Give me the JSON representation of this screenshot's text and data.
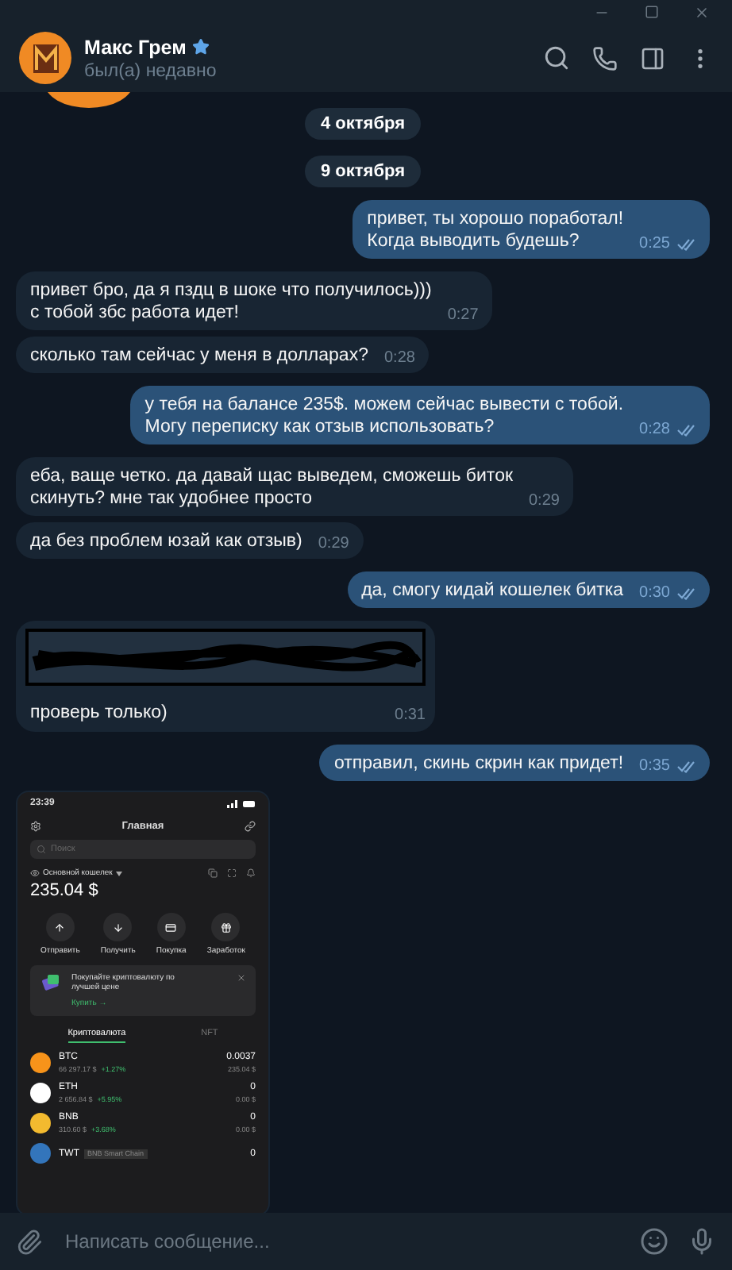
{
  "contact": {
    "name": "Макс Грем",
    "status": "был(а) недавно",
    "verified": true
  },
  "messages": [
    {
      "kind": "date",
      "text": "4 октября"
    },
    {
      "kind": "date",
      "text": "9 октября"
    },
    {
      "kind": "text",
      "outgoing": true,
      "text": "привет, ты хорошо поработал!\nКогда выводить будешь?",
      "time": "0:25",
      "read": true
    },
    {
      "kind": "text",
      "outgoing": false,
      "text": "привет бро, да я пздц в шоке что получилось)))\nс тобой збс работа идет!",
      "time": "0:27"
    },
    {
      "kind": "text",
      "outgoing": false,
      "text": "сколько там сейчас у меня в долларах?",
      "time": "0:28"
    },
    {
      "kind": "text",
      "outgoing": true,
      "text": "у тебя на балансе 235$. можем сейчас вывести с тобой.\nМогу переписку как отзыв использовать?",
      "time": "0:28",
      "read": true
    },
    {
      "kind": "text",
      "outgoing": false,
      "text": "еба, ваще четко. да давай щас выведем, сможешь биток\nскинуть? мне так удобнее просто",
      "time": "0:29"
    },
    {
      "kind": "text",
      "outgoing": false,
      "text": "да без проблем юзай как отзыв)",
      "time": "0:29"
    },
    {
      "kind": "text",
      "outgoing": true,
      "text": "да, смогу кидай кошелек битка",
      "time": "0:30",
      "read": true
    },
    {
      "kind": "redacted",
      "outgoing": false,
      "text": "проверь только)",
      "time": "0:31"
    },
    {
      "kind": "text",
      "outgoing": true,
      "text": "отправил, скинь скрин как придет!",
      "time": "0:35",
      "read": true
    },
    {
      "kind": "screenshot",
      "outgoing": false
    }
  ],
  "wallet_screenshot": {
    "clock": "23:39",
    "title": "Главная",
    "search_placeholder": "Поиск",
    "wallet_name": "Основной кошелек",
    "balance": "235.04 $",
    "actions": [
      "Отправить",
      "Получить",
      "Покупка",
      "Заработок"
    ],
    "promo": {
      "text": "Покупайте криптовалюту по лучшей цене",
      "link": "Купить →"
    },
    "tabs": [
      {
        "label": "Криптовалюта",
        "selected": true
      },
      {
        "label": "NFT",
        "selected": false
      }
    ],
    "coins": [
      {
        "symbol": "BTC",
        "color": "#f7931a",
        "price": "66 297.17 $",
        "change": "+1.27%",
        "amount": "0.0037",
        "value": "235.04 $"
      },
      {
        "symbol": "ETH",
        "color": "#ffffff",
        "price": "2 656.84 $",
        "change": "+5.95%",
        "amount": "0",
        "value": "0.00 $"
      },
      {
        "symbol": "BNB",
        "color": "#f3ba2f",
        "price": "310.60 $",
        "change": "+3.68%",
        "amount": "0",
        "value": "0.00 $"
      },
      {
        "symbol": "TWT",
        "color": "#3375bb",
        "tag": "BNB Smart Chain",
        "amount": "0"
      }
    ]
  },
  "composer": {
    "placeholder": "Написать сообщение..."
  }
}
